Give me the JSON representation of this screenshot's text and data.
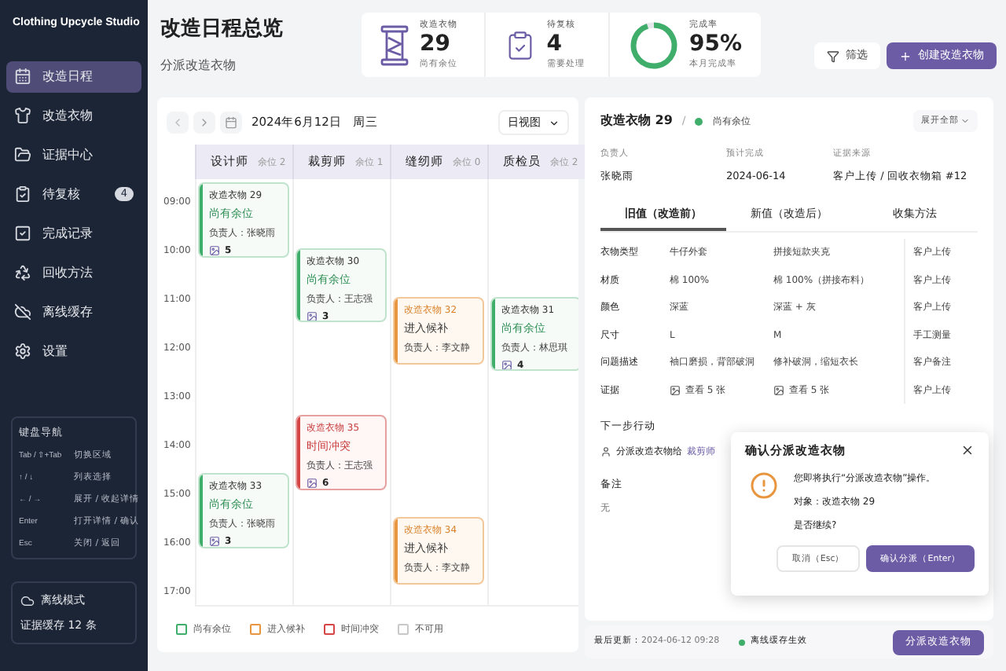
{
  "sidebar": {
    "app_title": "Clothing Upcycle Studio",
    "items": [
      {
        "label": "改造日程",
        "selected": true
      },
      {
        "label": "改造衣物",
        "selected": false
      },
      {
        "label": "证据中心",
        "selected": false
      },
      {
        "label": "待复核",
        "selected": false,
        "badge": "4"
      },
      {
        "label": "完成记录",
        "selected": false
      },
      {
        "label": "回收方法",
        "selected": false
      },
      {
        "label": "离线缓存",
        "selected": false
      },
      {
        "label": "设置",
        "selected": false
      }
    ],
    "shortcuts": {
      "title": "键盘导航",
      "rows": [
        {
          "key": "Tab / ⇧+Tab",
          "action": "切换区域"
        },
        {
          "key": "↑ / ↓",
          "action": "列表选择"
        },
        {
          "key": "← / →",
          "action": "展开 / 收起详情"
        },
        {
          "key": "Enter",
          "action": "打开详情 / 确认"
        },
        {
          "key": "Esc",
          "action": "关闭 / 返回"
        }
      ]
    },
    "offline": {
      "title": "离线模式",
      "text": "证据缓存 12 条"
    }
  },
  "header": {
    "title": "改造日程总览",
    "subtitle": "分派改造衣物",
    "stats": [
      {
        "kind": "spool",
        "label": "改造衣物",
        "value": "29",
        "note": "尚有余位"
      },
      {
        "kind": "clipboard",
        "label": "待复核",
        "value": "4",
        "note": "需要处理"
      },
      {
        "kind": "ring",
        "label": "完成率",
        "value": "95%",
        "note": "本月完成率",
        "level": 0.95
      }
    ],
    "filter_button": "筛选",
    "create_button": "创建改造衣物"
  },
  "calendar": {
    "date": "2024年6月12日",
    "weekday": "周三",
    "view": "日视图",
    "columns": [
      {
        "name": "设计师",
        "slots": "余位 2"
      },
      {
        "name": "裁剪师",
        "slots": "余位 1"
      },
      {
        "name": "缝纫师",
        "slots": "余位 0"
      },
      {
        "name": "质检员",
        "slots": "余位 2"
      }
    ],
    "times": [
      "09:00",
      "10:00",
      "11:00",
      "12:00",
      "13:00",
      "14:00",
      "15:00",
      "16:00",
      "17:00"
    ],
    "events": [
      {
        "title": "改造衣物 29",
        "status": "尚有余位",
        "kind": "available",
        "owner": "负责人：张晓雨",
        "count": "5"
      },
      {
        "title": "改造衣物 30",
        "status": "尚有余位",
        "kind": "available",
        "owner": "负责人：王志强",
        "count": "3"
      },
      {
        "title": "改造衣物 32",
        "status": "进入候补",
        "kind": "waitlist",
        "owner": "负责人：李文静"
      },
      {
        "title": "改造衣物 31",
        "status": "尚有余位",
        "kind": "available",
        "owner": "负责人：林思琪",
        "count": "4"
      },
      {
        "title": "改造衣物 35",
        "status": "时间冲突",
        "kind": "conflict",
        "owner": "负责人：王志强",
        "count": "6"
      },
      {
        "title": "改造衣物 33",
        "status": "尚有余位",
        "kind": "available",
        "owner": "负责人：张晓雨",
        "count": "3"
      },
      {
        "title": "改造衣物 34",
        "status": "进入候补",
        "kind": "waitlist",
        "owner": "负责人：李文静"
      }
    ],
    "legend": [
      {
        "kind": "available",
        "label": "尚有余位"
      },
      {
        "kind": "waitlist",
        "label": "进入候补"
      },
      {
        "kind": "conflict",
        "label": "时间冲突"
      },
      {
        "kind": "unavailable",
        "label": "不可用"
      }
    ]
  },
  "detail": {
    "title": "改造衣物 29",
    "separator": "/",
    "status": "尚有余位",
    "expand_button": "展开全部",
    "fields": [
      {
        "label": "负责人",
        "value": "张晓雨"
      },
      {
        "label": "预计完成",
        "value": "2024-06-14"
      },
      {
        "label": "证据来源",
        "value": "客户上传 / 回收衣物箱 #12"
      }
    ],
    "tabs": [
      {
        "label": "旧值（改造前）",
        "selected": true
      },
      {
        "label": "新值（改造后）",
        "selected": false
      },
      {
        "label": "收集方法",
        "selected": false
      }
    ],
    "rows": [
      {
        "kind": "text",
        "label": "衣物类型",
        "old": "牛仔外套",
        "new": "拼接短款夹克",
        "method": "客户上传"
      },
      {
        "kind": "text",
        "label": "材质",
        "old": "棉 100%",
        "new": "棉 100%（拼接布料）",
        "method": "客户上传"
      },
      {
        "kind": "text",
        "label": "颜色",
        "old": "深蓝",
        "new": "深蓝 + 灰",
        "method": "客户上传"
      },
      {
        "kind": "text",
        "label": "尺寸",
        "old": "L",
        "new": "M",
        "method": "手工测量"
      },
      {
        "kind": "text",
        "label": "问题描述",
        "old": "袖口磨损，背部破洞",
        "new": "修补破洞，缩短衣长",
        "method": "客户备注"
      },
      {
        "kind": "images",
        "label": "证据",
        "old": "查看 5 张",
        "new": "查看 5 张",
        "method": "客户上传"
      }
    ],
    "next_title": "下一步行动",
    "next_text": "分派改造衣物给",
    "next_link": "裁剪师",
    "notes_title": "备注",
    "notes": "无",
    "updated_label": "最后更新：",
    "updated": "2024-06-12 09:28",
    "cache": "离线缓存生效",
    "assign_button": "分派改造衣物"
  },
  "dialog": {
    "title": "确认分派改造衣物",
    "lines": [
      "您即将执行“分派改造衣物”操作。",
      "对象：改造衣物 29",
      "是否继续?"
    ],
    "cancel": "取消（Esc）",
    "confirm": "确认分派（Enter）"
  }
}
